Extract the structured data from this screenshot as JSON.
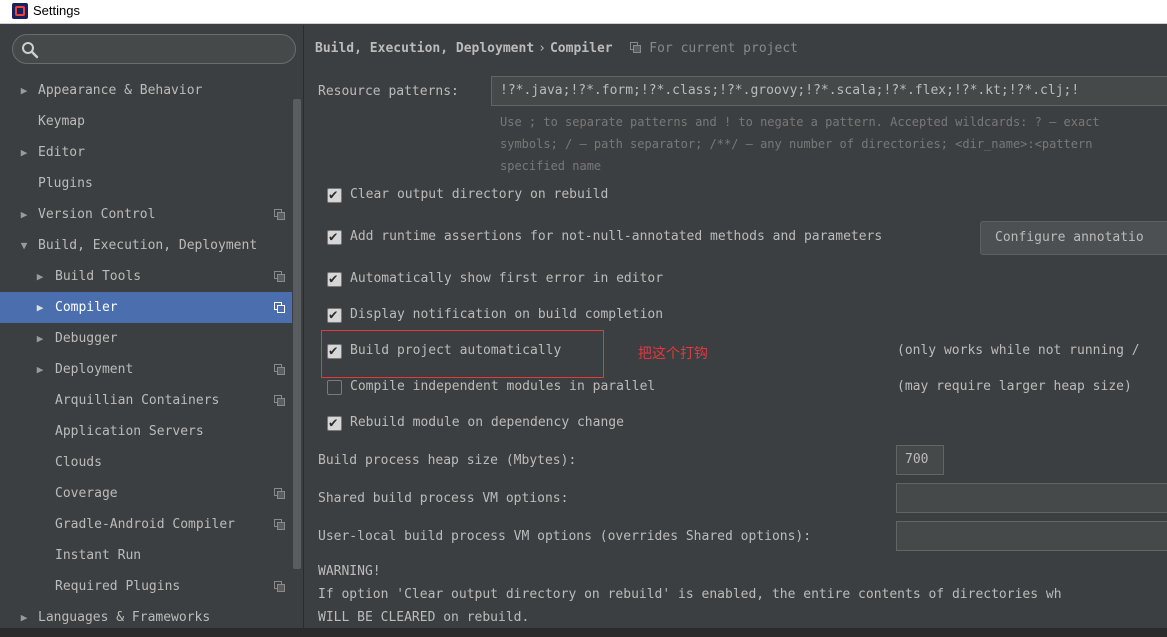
{
  "window": {
    "title": "Settings"
  },
  "search": {
    "placeholder": "",
    "value": ""
  },
  "sidebar": {
    "items": [
      {
        "label": "Appearance & Behavior",
        "arrow": "▶"
      },
      {
        "label": "Keymap"
      },
      {
        "label": "Editor",
        "arrow": "▶"
      },
      {
        "label": "Plugins"
      },
      {
        "label": "Version Control",
        "arrow": "▶"
      },
      {
        "label": "Build, Execution, Deployment",
        "arrow": "▼"
      },
      {
        "label": "Build Tools",
        "arrow": "▶"
      },
      {
        "label": "Compiler",
        "arrow": "▶",
        "selected": true
      },
      {
        "label": "Debugger",
        "arrow": "▶"
      },
      {
        "label": "Deployment",
        "arrow": "▶"
      },
      {
        "label": "Arquillian Containers"
      },
      {
        "label": "Application Servers"
      },
      {
        "label": "Clouds"
      },
      {
        "label": "Coverage"
      },
      {
        "label": "Gradle-Android Compiler"
      },
      {
        "label": "Instant Run"
      },
      {
        "label": "Required Plugins"
      },
      {
        "label": "Languages & Frameworks",
        "arrow": "▶"
      }
    ]
  },
  "breadcrumb": {
    "parent": "Build, Execution, Deployment",
    "separator": "›",
    "current": "Compiler",
    "scope": "For current project"
  },
  "resource_patterns": {
    "label": "Resource patterns:",
    "value": "!?*.java;!?*.form;!?*.class;!?*.groovy;!?*.scala;!?*.flex;!?*.kt;!?*.clj;!",
    "hint_line1": "Use ; to separate patterns and ! to negate a pattern. Accepted wildcards: ? — exact",
    "hint_line2": "symbols; / — path separator; /**/ — any number of directories; <dir_name>:<pattern",
    "hint_line3": "specified name"
  },
  "options": {
    "clear_output": "Clear output directory on rebuild",
    "runtime_assertions": "Add runtime assertions for not-null-annotated methods and parameters",
    "configure_button": "Configure annotatio",
    "show_first_error": "Automatically show first error in editor",
    "display_notification": "Display notification on build completion",
    "build_automatically": "Build project automatically",
    "build_auto_note": "(only works while not running /",
    "compile_parallel": "Compile independent modules in parallel",
    "compile_parallel_note": "(may require larger heap size)",
    "rebuild_module": "Rebuild module on dependency change"
  },
  "annotation": {
    "text": "把这个打钩",
    "color": "#e03b3b"
  },
  "heap": {
    "label": "Build process heap size (Mbytes):",
    "value": "700"
  },
  "shared_vm": {
    "label": "Shared build process VM options:",
    "value": ""
  },
  "user_vm": {
    "label": "User-local build process VM options (overrides Shared options):",
    "value": ""
  },
  "warning": {
    "title": "WARNING!",
    "line1": "If option 'Clear output directory on rebuild' is enabled, the entire contents of directories wh",
    "line2": "WILL BE CLEARED on rebuild."
  },
  "colors": {
    "selection": "#4b6eaf",
    "background": "#3c3f41"
  }
}
